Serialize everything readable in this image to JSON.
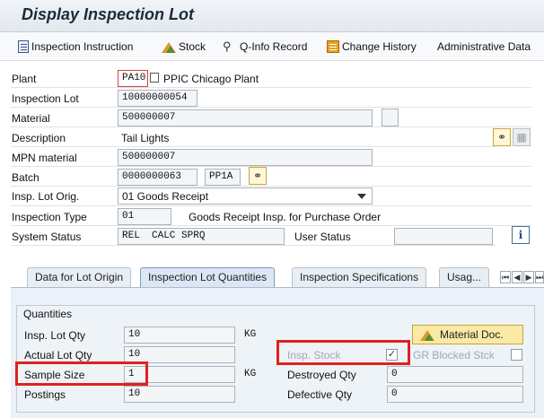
{
  "window": {
    "title": "Display Inspection Lot"
  },
  "toolbar": {
    "items": [
      {
        "label": "Inspection Instruction",
        "icon": "document-icon"
      },
      {
        "label": "Stock",
        "icon": "stock-icon"
      },
      {
        "label": "Q-Info Record",
        "icon": "qinfo-icon"
      },
      {
        "label": "Change History",
        "icon": "history-icon"
      },
      {
        "label": "Administrative Data"
      }
    ]
  },
  "header": {
    "plant_label": "Plant",
    "plant_value": "PA10",
    "plant_desc": "PPIC Chicago Plant",
    "lot_label": "Inspection Lot",
    "lot_value": "10000000054",
    "material_label": "Material",
    "material_value": "500000007",
    "description_label": "Description",
    "description_value": "Tail Lights",
    "mpn_label": "MPN material",
    "mpn_value": "500000007",
    "batch_label": "Batch",
    "batch_value": "0000000063",
    "batch_extra": "PP1A",
    "origin_label": "Insp. Lot Orig.",
    "origin_value": "01 Goods Receipt",
    "type_label": "Inspection Type",
    "type_value": "01",
    "type_desc": "Goods Receipt Insp. for Purchase Order",
    "status_label": "System Status",
    "status_value": "REL  CALC SPRQ",
    "user_status_label": "User Status",
    "user_status_value": ""
  },
  "tabs": [
    {
      "label": "Data for Lot Origin"
    },
    {
      "label": "Inspection Lot Quantities"
    },
    {
      "label": "Inspection Specifications"
    },
    {
      "label": "Usag..."
    }
  ],
  "quantities": {
    "title": "Quantities",
    "lot_qty_label": "Insp. Lot Qty",
    "lot_qty_value": "10",
    "lot_qty_unit": "KG",
    "actual_qty_label": "Actual Lot Qty",
    "actual_qty_value": "10",
    "sample_label": "Sample Size",
    "sample_value": "1",
    "sample_unit": "KG",
    "postings_label": "Postings",
    "postings_value": "10",
    "material_doc_label": "Material Doc.",
    "insp_stock_label": "Insp. Stock",
    "insp_stock_checked": "✓",
    "gr_blocked_label": "GR Blocked Stck",
    "destroyed_label": "Destroyed Qty",
    "destroyed_value": "0",
    "defective_label": "Defective Qty",
    "defective_value": "0"
  }
}
